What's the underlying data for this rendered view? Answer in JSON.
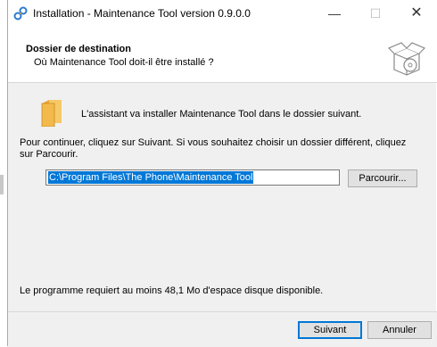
{
  "window": {
    "title": "Installation - Maintenance Tool version 0.9.0.0",
    "controls": {
      "minimize": "—",
      "maximize": "☐",
      "close": "✕"
    }
  },
  "header": {
    "title": "Dossier de destination",
    "subtitle": "Où Maintenance Tool doit-il être installé ?"
  },
  "body": {
    "intro": "L'assistant va installer Maintenance Tool dans le dossier suivant.",
    "instruction": "Pour continuer, cliquez sur Suivant. Si vous souhaitez choisir un dossier différent, cliquez sur Parcourir.",
    "path_value": "C:\\Program Files\\The Phone\\Maintenance Tool",
    "browse_label": "Parcourir...",
    "space_required": "Le programme requiert au moins 48,1 Mo d'espace disque disponible."
  },
  "footer": {
    "next_label": "Suivant",
    "cancel_label": "Annuler"
  },
  "colors": {
    "selection": "#0078d7",
    "folder": "#f3b94a"
  }
}
